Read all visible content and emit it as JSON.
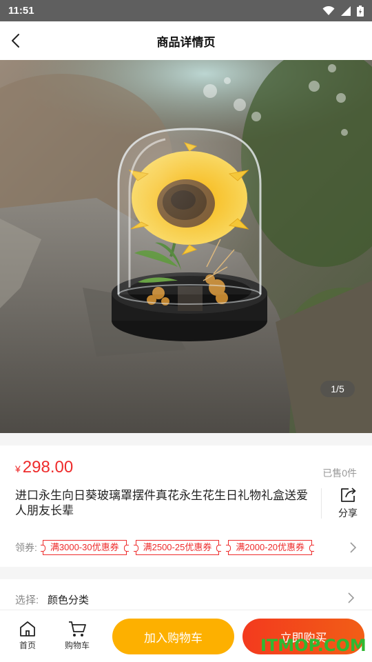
{
  "status_bar": {
    "time": "11:51",
    "icons": [
      "wifi-icon",
      "signal-icon",
      "battery-icon"
    ]
  },
  "nav": {
    "title": "商品详情页",
    "back_icon": "chevron-left-icon"
  },
  "gallery": {
    "pager": "1/5",
    "image": "sunflower in glass dome on rock"
  },
  "product": {
    "currency": "¥",
    "price": "298.00",
    "sold": "已售0件",
    "title": "进口永生向日葵玻璃罩摆件真花永生花生日礼物礼盒送爱人朋友长辈",
    "share_label": "分享"
  },
  "coupons": {
    "label": "领券:",
    "items": [
      "满3000-30优惠券",
      "满2500-25优惠券",
      "满2000-20优惠券"
    ]
  },
  "spec": {
    "label": "选择:",
    "value": "颜色分类"
  },
  "bottom": {
    "home_label": "首页",
    "cart_label": "购物车",
    "add_cart": "加入购物车",
    "buy_now": "立即购买"
  },
  "watermark": "ITMOP.COM",
  "colors": {
    "price_red": "#ee2b2b",
    "add_cart_yellow": "#fdb000",
    "buy_red": "#f33a1e",
    "watermark_green": "#2fb832"
  }
}
